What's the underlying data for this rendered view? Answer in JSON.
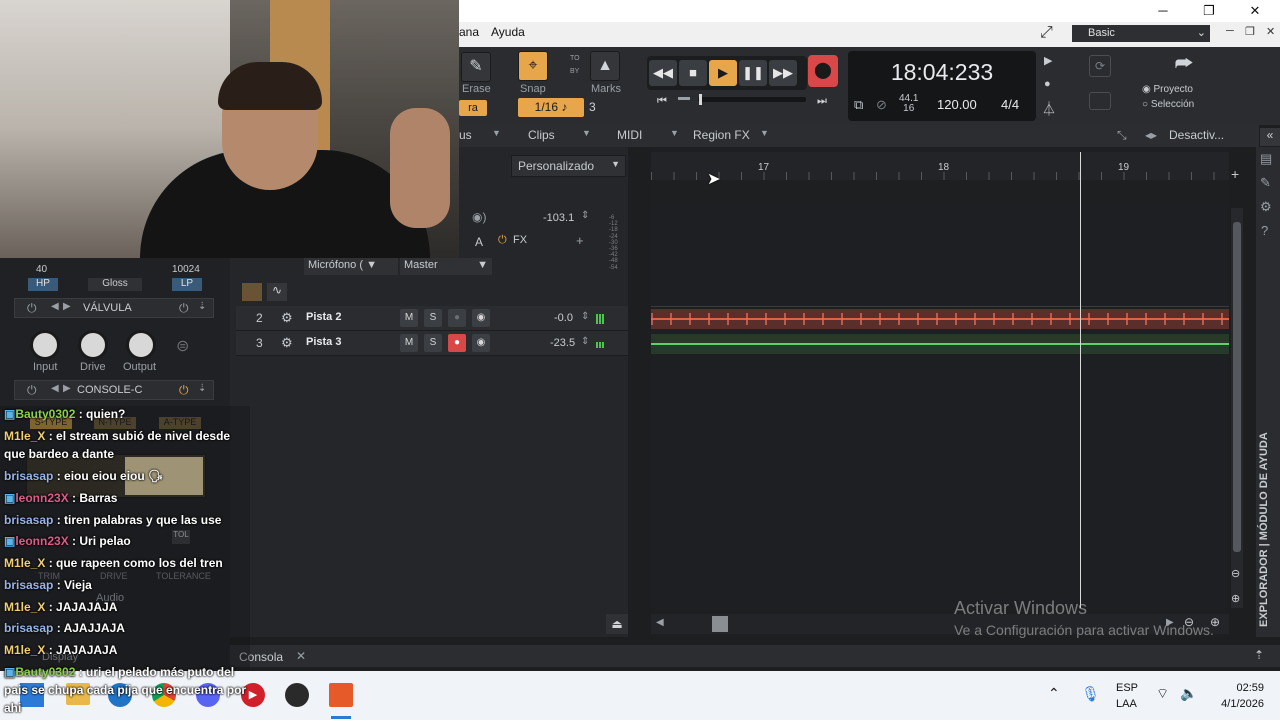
{
  "menu": {
    "ana": "ana",
    "ayuda": "Ayuda"
  },
  "mode": {
    "label": "Basic"
  },
  "toolbar": {
    "erase": "Erase",
    "snap": "Snap",
    "marks": "Marks",
    "snap_value": "1/16",
    "snap_num": "3",
    "to": "TO",
    "by": "BY",
    "partial": "ra"
  },
  "transport": {
    "time": "18:04:233",
    "sample_rate_top": "44.1",
    "sample_rate_bottom": "16",
    "tempo": "120.00",
    "signature": "4/4"
  },
  "radios": {
    "proyecto": "Proyecto",
    "seleccion": "Selección"
  },
  "tabs": {
    "us": "us",
    "clips": "Clips",
    "midi": "MIDI",
    "regionfx": "Region FX",
    "desactiv": "Desactiv..."
  },
  "track_area": {
    "preset": "Personalizado",
    "vol_top": "-103.1",
    "fx": "FX",
    "input": "Micrófono (",
    "output": "Master"
  },
  "tracks": [
    {
      "num": "2",
      "name": "Pista 2",
      "m": "M",
      "s": "S",
      "vol": "-0.0"
    },
    {
      "num": "3",
      "name": "Pista 3",
      "m": "M",
      "s": "S",
      "vol": "-23.5"
    }
  ],
  "ruler": {
    "m17": "17",
    "m18": "18",
    "m19": "19"
  },
  "console": {
    "label": "Consola",
    "close": "✕"
  },
  "side_panel": {
    "label": "EXPLORADOR | MÓDULO DE AYUDA"
  },
  "watermark": {
    "line1": "Activar Windows",
    "line2": "Ve a Configuración para activar Windows."
  },
  "plugins": {
    "hp_val": "40",
    "lp_val": "10024",
    "hp": "HP",
    "gloss": "Gloss",
    "lp": "LP",
    "valvula": "VÁLVULA",
    "input": "Input",
    "drive": "Drive",
    "output": "Output",
    "console_c": "CONSOLE-C",
    "stype": "S-TYPE",
    "ntype": "N-TYPE",
    "atype": "A-TYPE",
    "trim": "TRIM",
    "drive2": "DRIVE",
    "tolerance": "TOLERANCE",
    "tol": "TOL",
    "audio": "Audio",
    "display": "Display"
  },
  "chat": [
    {
      "user": "Bauty0302",
      "color": "#8bd24c",
      "msg": " : quien?"
    },
    {
      "user": "M1le_X",
      "color": "#f0d070",
      "msg": " : el stream subió de nivel desde que bardeo a dante"
    },
    {
      "user": "brisasap",
      "color": "#9ab4e8",
      "msg": " : eiou eiou eiou 🗣"
    },
    {
      "user": "leonn23X",
      "color": "#e05a8a",
      "msg": " : Barras"
    },
    {
      "user": "brisasap",
      "color": "#9ab4e8",
      "msg": " : tiren palabras y que las use"
    },
    {
      "user": "leonn23X",
      "color": "#e05a8a",
      "msg": " : Uri pelao"
    },
    {
      "user": "M1le_X",
      "color": "#f0d070",
      "msg": " : que rapeen como los del tren"
    },
    {
      "user": "brisasap",
      "color": "#9ab4e8",
      "msg": " : Vieja"
    },
    {
      "user": "M1le_X",
      "color": "#f0d070",
      "msg": " : JAJAJAJA"
    },
    {
      "user": "brisasap",
      "color": "#9ab4e8",
      "msg": " : AJAJJAJA"
    },
    {
      "user": "M1le_X",
      "color": "#f0d070",
      "msg": " : JAJAJAJA"
    },
    {
      "user": "Bauty0302",
      "color": "#8bd24c",
      "msg": " : uri el pelado más puto del pais se chupa cada pija que encuentra por ahi"
    }
  ],
  "taskbar": {
    "lang1": "ESP",
    "lang2": "LAA",
    "clock": "02:59",
    "date": "4/1/2026"
  }
}
